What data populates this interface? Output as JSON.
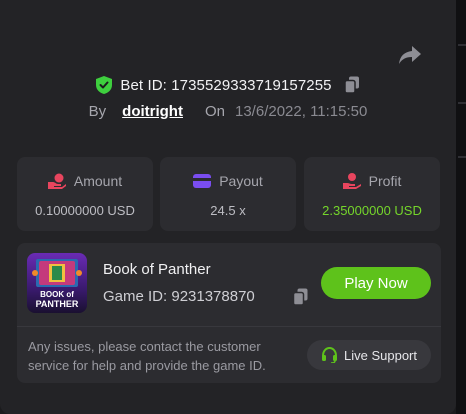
{
  "bet": {
    "label": "Bet ID: 1735529333719157255",
    "by_label": "By",
    "username": "doitright",
    "on_label": "On",
    "date": "13/6/2022, 11:15:50"
  },
  "stats": [
    {
      "label": "Amount",
      "value": "0.10000000 USD",
      "icon": "coins-hand-icon"
    },
    {
      "label": "Payout",
      "value": "24.5 x",
      "icon": "card-icon"
    },
    {
      "label": "Profit",
      "value": "2.35000000 USD",
      "icon": "profit-hand-icon"
    }
  ],
  "game": {
    "title": "Book of Panther",
    "id_label": "Game ID: 9231378870",
    "thumb_text_1": "BOOK of",
    "thumb_text_2": "PANTHER",
    "play_label": "Play Now",
    "issue_text": "Any issues, please contact the customer service for help and provide the game ID.",
    "support_label": "Live Support"
  },
  "colors": {
    "accent_green": "#5ec21b",
    "profit_green": "#75d62b",
    "amount_icon": "#e8455e",
    "payout_icon": "#7a4df0",
    "profit_icon": "#e8455e",
    "verified_shield": "#3ecf3e"
  }
}
